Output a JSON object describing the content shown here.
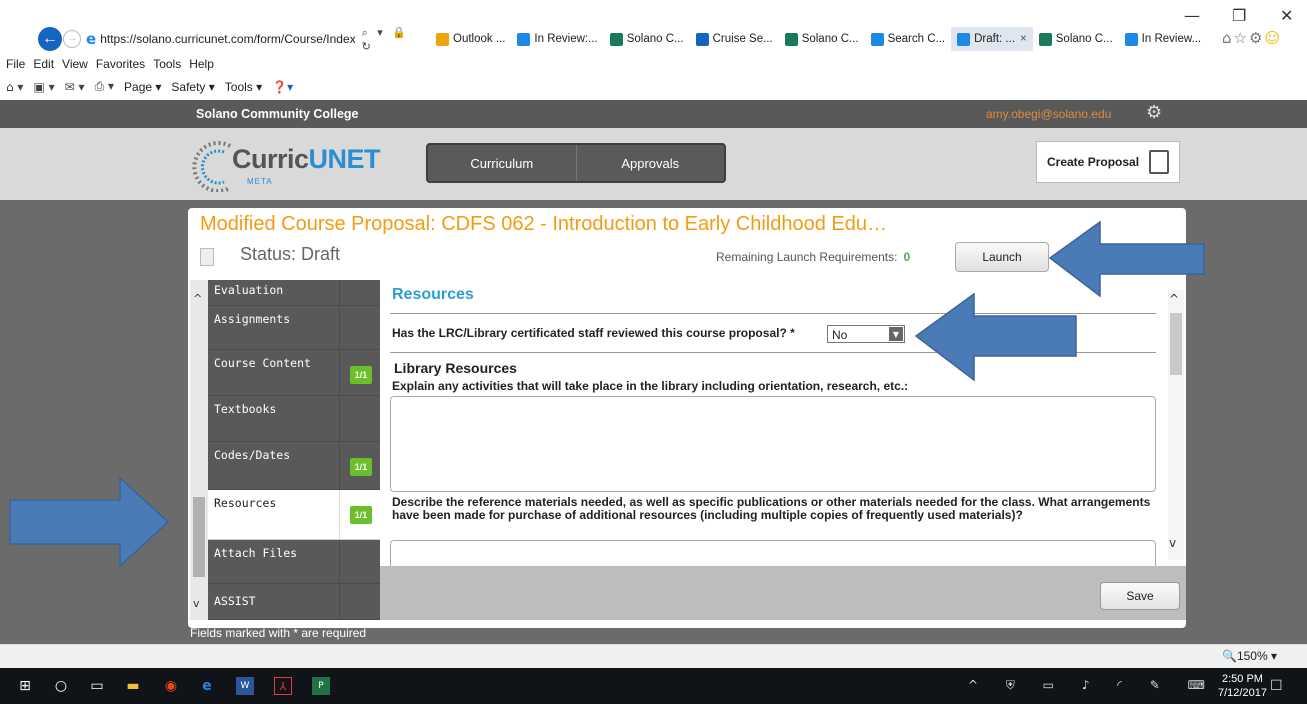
{
  "browser": {
    "window_controls": [
      "—",
      "❐",
      "✕"
    ],
    "url": "https://solano.curricunet.com/form/Course/Index",
    "address_controls": "⌕ ▾ 🔒 ↻",
    "tabs": [
      {
        "label": "Outlook ...",
        "color": "#f0a30a",
        "active": false
      },
      {
        "label": "In Review:...",
        "color": "#1e88e5",
        "active": false
      },
      {
        "label": "Solano C...",
        "color": "#1b7a5a",
        "active": false
      },
      {
        "label": "Cruise Se...",
        "color": "#1565c0",
        "active": false
      },
      {
        "label": "Solano C...",
        "color": "#1b7a5a",
        "active": false
      },
      {
        "label": "Search C...",
        "color": "#1e88e5",
        "active": false
      },
      {
        "label": "Draft: ...",
        "color": "#1e88e5",
        "active": true
      },
      {
        "label": "Solano C...",
        "color": "#1b7a5a",
        "active": false
      },
      {
        "label": "In Review...",
        "color": "#1e88e5",
        "active": false
      }
    ],
    "close_tab_glyph": "×",
    "menu": [
      "File",
      "Edit",
      "View",
      "Favorites",
      "Tools",
      "Help"
    ],
    "commands": [
      "Page ▾",
      "Safety ▾",
      "Tools ▾"
    ],
    "zoom": "150%"
  },
  "site": {
    "college": "Solano Community College",
    "user_email": "amy.obegi@solano.edu",
    "logo_main": "Curric",
    "logo_accent": "UNET",
    "logo_sub": "META",
    "nav": [
      "Curriculum",
      "Approvals"
    ],
    "create_proposal": "Create Proposal"
  },
  "proposal": {
    "title": "Modified Course Proposal: CDFS 062 - Introduction to Early Childhood Edu…",
    "status": "Status: Draft",
    "remaining_label": "Remaining Launch Requirements:",
    "remaining_count": "0",
    "launch": "Launch"
  },
  "sidebar": {
    "items": [
      {
        "label": "Evaluation",
        "badge": ""
      },
      {
        "label": "Assignments",
        "badge": ""
      },
      {
        "label": "Course Content",
        "badge": "1/1"
      },
      {
        "label": "Textbooks",
        "badge": ""
      },
      {
        "label": "Codes/Dates",
        "badge": "1/1"
      },
      {
        "label": "Resources",
        "badge": "1/1",
        "active": true
      },
      {
        "label": "Attach Files",
        "badge": ""
      },
      {
        "label": "ASSIST",
        "badge": ""
      }
    ]
  },
  "form": {
    "section_title": "Resources",
    "question": "Has the LRC/Library certificated staff reviewed this course proposal? *",
    "question_value": "No",
    "subsection": "Library Resources",
    "field1_label": "Explain any activities that will take place in the library including orientation, research, etc.:",
    "field2_label": "Describe the reference materials needed, as well as specific publications or other materials needed for the class. What arrangements have been made for purchase of additional resources (including multiple copies of frequently used materials)?",
    "save": "Save",
    "required_note": "Fields marked with * are required"
  },
  "taskbar": {
    "time": "2:50 PM",
    "date": "7/12/2017"
  },
  "colors": {
    "title_orange": "#f39c12",
    "section_blue": "#2a9fd6",
    "badge_green": "#6cbf2a",
    "arrow_blue": "#4a7bb7"
  }
}
